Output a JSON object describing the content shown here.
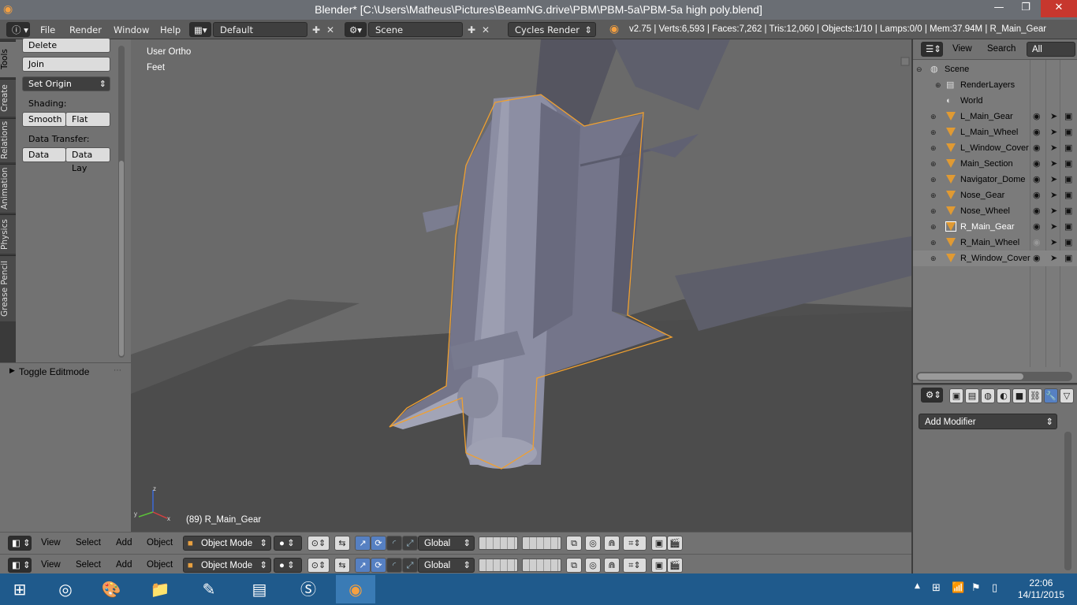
{
  "window": {
    "title": "Blender* [C:\\Users\\Matheus\\Pictures\\BeamNG.drive\\PBM\\PBM-5a\\PBM-5a high poly.blend]",
    "minimize": "—",
    "maximize": "❐",
    "close": "✕"
  },
  "info_header": {
    "menus": [
      "File",
      "Render",
      "Window",
      "Help"
    ],
    "screen_layout": "Default",
    "scene": "Scene",
    "render_engine": "Cycles Render",
    "stats": "v2.75 | Verts:6,593 | Faces:7,262 | Tris:12,060 | Objects:1/10 | Lamps:0/0 | Mem:37.94M | R_Main_Gear"
  },
  "tool_tabs": [
    "Tools",
    "Create",
    "Relations",
    "Animation",
    "Physics",
    "Grease Pencil"
  ],
  "tool_shelf": {
    "delete": "Delete",
    "join": "Join",
    "set_origin": "Set Origin",
    "shading_label": "Shading:",
    "smooth": "Smooth",
    "flat": "Flat",
    "data_transfer_label": "Data Transfer:",
    "data": "Data",
    "data_lay": "Data Lay",
    "toggle_editmode": "Toggle Editmode"
  },
  "viewport": {
    "view_name": "User Ortho",
    "units": "Feet",
    "object_info": "(89) R_Main_Gear",
    "axis_z": "z",
    "axis_y": "y",
    "axis_x": "x"
  },
  "view3d_header": {
    "menus": [
      "View",
      "Select",
      "Add",
      "Object"
    ],
    "mode": "Object Mode",
    "orientation": "Global"
  },
  "outliner": {
    "menus": [
      "View",
      "Search",
      "All Scenes"
    ],
    "scene": "Scene",
    "render_layers": "RenderLayers",
    "world": "World",
    "objects": [
      "L_Main_Gear",
      "L_Main_Wheel",
      "L_Window_Cover",
      "Main_Section",
      "Navigator_Dome",
      "Nose_Gear",
      "Nose_Wheel",
      "R_Main_Gear",
      "R_Main_Wheel",
      "R_Window_Cover"
    ]
  },
  "properties": {
    "add_modifier": "Add Modifier"
  },
  "taskbar": {
    "time": "22:06",
    "date": "14/11/2015"
  },
  "colors": {
    "selection_outline": "#f0a030",
    "viewport_bg": "#4f4f4f",
    "panel_bg": "#727272"
  }
}
